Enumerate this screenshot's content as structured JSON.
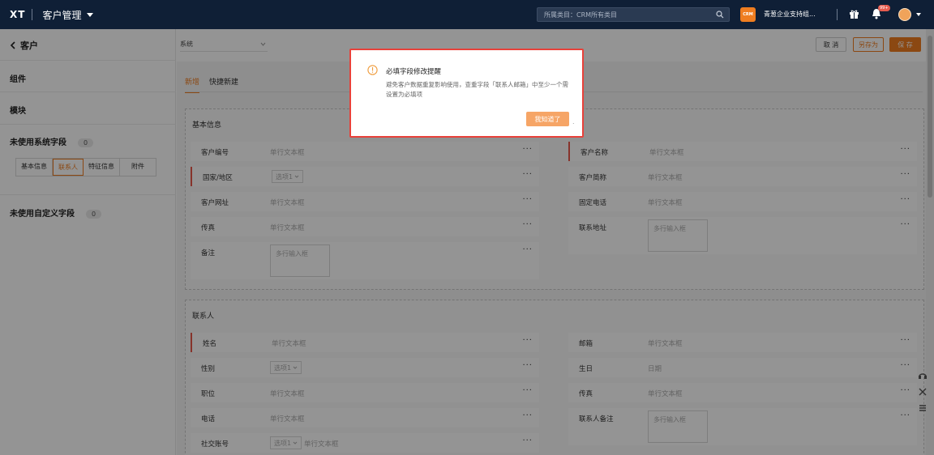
{
  "topbar": {
    "logo": "XT",
    "app_title": "客户管理",
    "search_placeholder": "所属类目：CRM所有类目",
    "org_badge": "CRM",
    "org_name": "青葱企业支持组...",
    "notification_count": "99+"
  },
  "left_panel": {
    "title": "客户",
    "components": "组件",
    "modules": "模块",
    "unused_system_fields": "未使用系统字段",
    "unused_system_count": "0",
    "field_tabs": [
      "基本信息",
      "联系人",
      "特征信息",
      "附件"
    ],
    "active_field_tab": 1,
    "unused_custom_fields": "未使用自定义字段",
    "unused_custom_count": "0"
  },
  "toolbar": {
    "system_select": "系统",
    "cancel": "取 消",
    "save_as": "另存为",
    "save": "保 存"
  },
  "tabs": [
    "新增",
    "快捷新建"
  ],
  "sections": {
    "basic": {
      "title": "基本信息",
      "left": [
        {
          "label": "客户编号",
          "placeholder": "单行文本框",
          "required": false,
          "kind": "text"
        },
        {
          "label": "国家/地区",
          "placeholder": "选项1",
          "required": true,
          "kind": "select"
        },
        {
          "label": "客户网址",
          "placeholder": "单行文本框",
          "required": false,
          "kind": "text"
        },
        {
          "label": "传真",
          "placeholder": "单行文本框",
          "required": false,
          "kind": "text"
        },
        {
          "label": "备注",
          "placeholder": "多行输入框",
          "required": false,
          "kind": "textarea"
        }
      ],
      "right": [
        {
          "label": "客户名称",
          "placeholder": "单行文本框",
          "required": true,
          "kind": "text"
        },
        {
          "label": "客户简称",
          "placeholder": "单行文本框",
          "required": false,
          "kind": "text"
        },
        {
          "label": "固定电话",
          "placeholder": "单行文本框",
          "required": false,
          "kind": "text"
        },
        {
          "label": "联系地址",
          "placeholder": "多行输入框",
          "required": false,
          "kind": "textarea"
        }
      ]
    },
    "contact": {
      "title": "联系人",
      "left": [
        {
          "label": "姓名",
          "placeholder": "单行文本框",
          "required": true,
          "kind": "text"
        },
        {
          "label": "性别",
          "placeholder": "选项1",
          "required": false,
          "kind": "select"
        },
        {
          "label": "职位",
          "placeholder": "单行文本框",
          "required": false,
          "kind": "text"
        },
        {
          "label": "电话",
          "placeholder": "单行文本框",
          "required": false,
          "kind": "text"
        },
        {
          "label": "社交账号",
          "placeholder": "选项1",
          "placeholder2": "单行文本框",
          "required": false,
          "kind": "select-text"
        }
      ],
      "right": [
        {
          "label": "邮箱",
          "placeholder": "单行文本框",
          "required": false,
          "kind": "text"
        },
        {
          "label": "生日",
          "placeholder": "日期",
          "required": false,
          "kind": "text"
        },
        {
          "label": "传真",
          "placeholder": "单行文本框",
          "required": false,
          "kind": "text"
        },
        {
          "label": "联系人备注",
          "placeholder": "多行输入框",
          "required": false,
          "kind": "textarea"
        }
      ]
    }
  },
  "modal": {
    "title": "必填字段修改提醒",
    "body": "避免客户数据重复影响使用，查重字段「联系人邮箱」中至少一个需设置为必填项",
    "ok": "我知道了",
    "dot": "."
  },
  "colors": {
    "accent": "#ef7d20",
    "required": "#e8584a",
    "header": "#0f1f36"
  }
}
